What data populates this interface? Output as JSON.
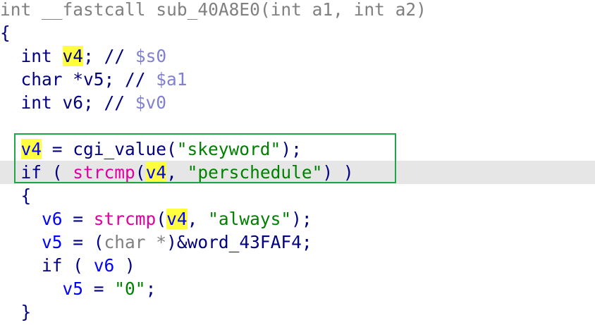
{
  "code": {
    "signature": {
      "ret": "int",
      "conv": "__fastcall",
      "name": "sub_40A8E0",
      "params": "(int a1, int a2)"
    },
    "brace_open": "{",
    "decl_v4": {
      "type": "int",
      "var": "v4",
      "rest": "; // ",
      "reg": "$s0"
    },
    "decl_v5": {
      "text": "char *v5; // ",
      "reg": "$a1"
    },
    "decl_v6": {
      "text": "int v6; // ",
      "reg": "$v0"
    },
    "assign_v4": {
      "var": "v4",
      "op": " = cgi_value(",
      "str": "\"skeyword\"",
      "end": ");"
    },
    "if_strcmp": {
      "kw": "if ( ",
      "fn": "strcmp",
      "paren": "(",
      "var": "v4",
      "comma": ", ",
      "str": "\"perschedule\"",
      "end": ") )"
    },
    "inner_open": "{",
    "assign_v6": {
      "var": "v6",
      "op": " = ",
      "fn": "strcmp",
      "paren": "(",
      "var2": "v4",
      "comma": ", ",
      "str": "\"always\"",
      "end": ");"
    },
    "assign_v5": {
      "var": "v5",
      "op": " = (",
      "cast": "char *",
      "rest": ")&word_43FAF4;"
    },
    "if_v6": {
      "kw": "if ( ",
      "var": "v6",
      "end": " )"
    },
    "assign_v5_zero": {
      "var": "v5",
      "op": " = ",
      "str": "\"0\"",
      "end": ";"
    },
    "inner_close": "}"
  },
  "colors": {
    "keyword": "#000080",
    "comment_register": "#8080d0",
    "string": "#008000",
    "library_call": "#e000a0",
    "variable": "#0000ff",
    "search_highlight": "#ffff40",
    "current_line": "#e6e6e6",
    "annotation_box": "#22a44a"
  }
}
